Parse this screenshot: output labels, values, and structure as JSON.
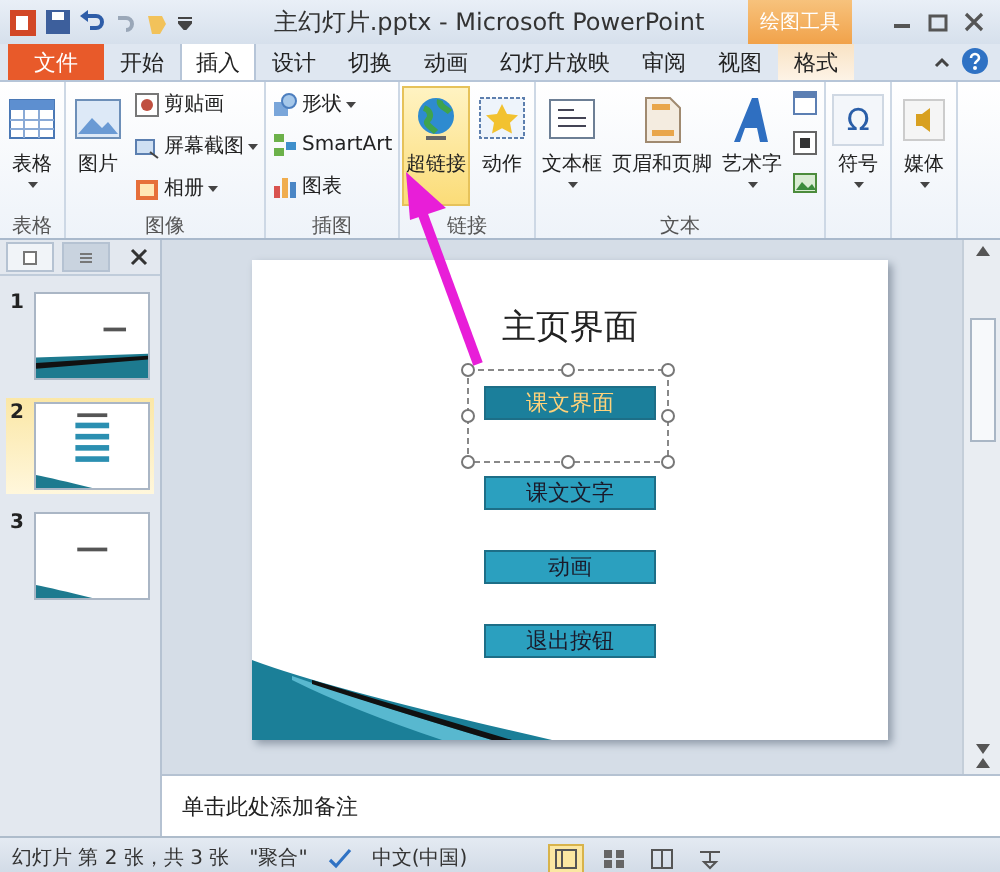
{
  "window": {
    "title": "主幻灯片.pptx - Microsoft PowerPoint",
    "context_tab": "绘图工具"
  },
  "tabs": [
    {
      "label": "文件",
      "kind": "file",
      "selected": false
    },
    {
      "label": "开始",
      "kind": "normal",
      "selected": false
    },
    {
      "label": "插入",
      "kind": "normal",
      "selected": true
    },
    {
      "label": "设计",
      "kind": "normal",
      "selected": false
    },
    {
      "label": "切换",
      "kind": "normal",
      "selected": false
    },
    {
      "label": "动画",
      "kind": "normal",
      "selected": false
    },
    {
      "label": "幻灯片放映",
      "kind": "normal",
      "selected": false
    },
    {
      "label": "审阅",
      "kind": "normal",
      "selected": false
    },
    {
      "label": "视图",
      "kind": "normal",
      "selected": false
    },
    {
      "label": "格式",
      "kind": "context",
      "selected": false
    }
  ],
  "ribbon": {
    "groups": [
      {
        "label": "表格",
        "columns": [
          {
            "kind": "large",
            "items": [
              {
                "label": "表格",
                "kind": "table",
                "dropdown": true,
                "selected": false
              }
            ]
          }
        ]
      },
      {
        "label": "图像",
        "columns": [
          {
            "kind": "large",
            "items": [
              {
                "label": "图片",
                "kind": "picture",
                "dropdown": false,
                "selected": false
              }
            ]
          },
          {
            "kind": "small",
            "items": [
              {
                "label": "剪贴画",
                "kind": "clipart",
                "dropdown": false,
                "selected": false
              },
              {
                "label": "屏幕截图",
                "kind": "screenshot",
                "dropdown": true,
                "selected": false
              },
              {
                "label": "相册",
                "kind": "album",
                "dropdown": true,
                "selected": false
              }
            ]
          }
        ]
      },
      {
        "label": "插图",
        "columns": [
          {
            "kind": "small",
            "items": [
              {
                "label": "形状",
                "kind": "shapes",
                "dropdown": true,
                "selected": false
              },
              {
                "label": "SmartArt",
                "kind": "smartart",
                "dropdown": false,
                "selected": false
              },
              {
                "label": "图表",
                "kind": "chart",
                "dropdown": false,
                "selected": false
              }
            ]
          }
        ]
      },
      {
        "label": "链接",
        "columns": [
          {
            "kind": "large",
            "items": [
              {
                "label": "超链接",
                "kind": "globe",
                "dropdown": false,
                "selected": true
              }
            ]
          },
          {
            "kind": "large",
            "items": [
              {
                "label": "动作",
                "kind": "star",
                "dropdown": false,
                "selected": false
              }
            ]
          }
        ]
      },
      {
        "label": "文本",
        "columns": [
          {
            "kind": "large",
            "items": [
              {
                "label": "文本框",
                "kind": "textbox",
                "dropdown": true,
                "selected": false
              }
            ]
          },
          {
            "kind": "large",
            "items": [
              {
                "label": "页眉和页脚",
                "kind": "page",
                "dropdown": false,
                "selected": false
              }
            ]
          },
          {
            "kind": "large",
            "items": [
              {
                "label": "艺术字",
                "kind": "wordart",
                "dropdown": true,
                "selected": false
              }
            ]
          },
          {
            "kind": "small",
            "items": [
              {
                "kind": "calendar",
                "dropdown": false,
                "selected": false
              },
              {
                "kind": "frame",
                "dropdown": false,
                "selected": false
              },
              {
                "kind": "image",
                "dropdown": false,
                "selected": false
              }
            ]
          }
        ]
      },
      {
        "columns": [
          {
            "kind": "large",
            "items": [
              {
                "label": "符号",
                "glyph": "Ω",
                "kind": "symbol",
                "dropdown": true,
                "selected": false
              }
            ]
          }
        ]
      },
      {
        "columns": [
          {
            "kind": "large",
            "items": [
              {
                "label": "媒体",
                "kind": "media",
                "dropdown": true,
                "selected": false
              }
            ]
          }
        ]
      }
    ]
  },
  "slides": [
    {
      "number": "1",
      "kind": "title",
      "selected": false
    },
    {
      "number": "2",
      "kind": "menu",
      "selected": true
    },
    {
      "number": "3",
      "kind": "section",
      "selected": false
    }
  ],
  "slide": {
    "title": "主页界面",
    "buttons": [
      {
        "label": "课文界面",
        "selected": true
      },
      {
        "label": "课文文字",
        "selected": false
      },
      {
        "label": "动画",
        "selected": false
      },
      {
        "label": "退出按钮",
        "selected": false
      }
    ]
  },
  "notes": {
    "placeholder": "单击此处添加备注"
  },
  "status_bar": {
    "slide_info": "幻灯片 第 2 张，共 3 张",
    "theme": "\"聚合\"",
    "language": "中文(中国)",
    "views": [
      {
        "kind": "normal",
        "selected": true
      },
      {
        "kind": "sorter",
        "selected": false
      },
      {
        "kind": "reading",
        "selected": false
      },
      {
        "kind": "show",
        "selected": false
      }
    ]
  }
}
